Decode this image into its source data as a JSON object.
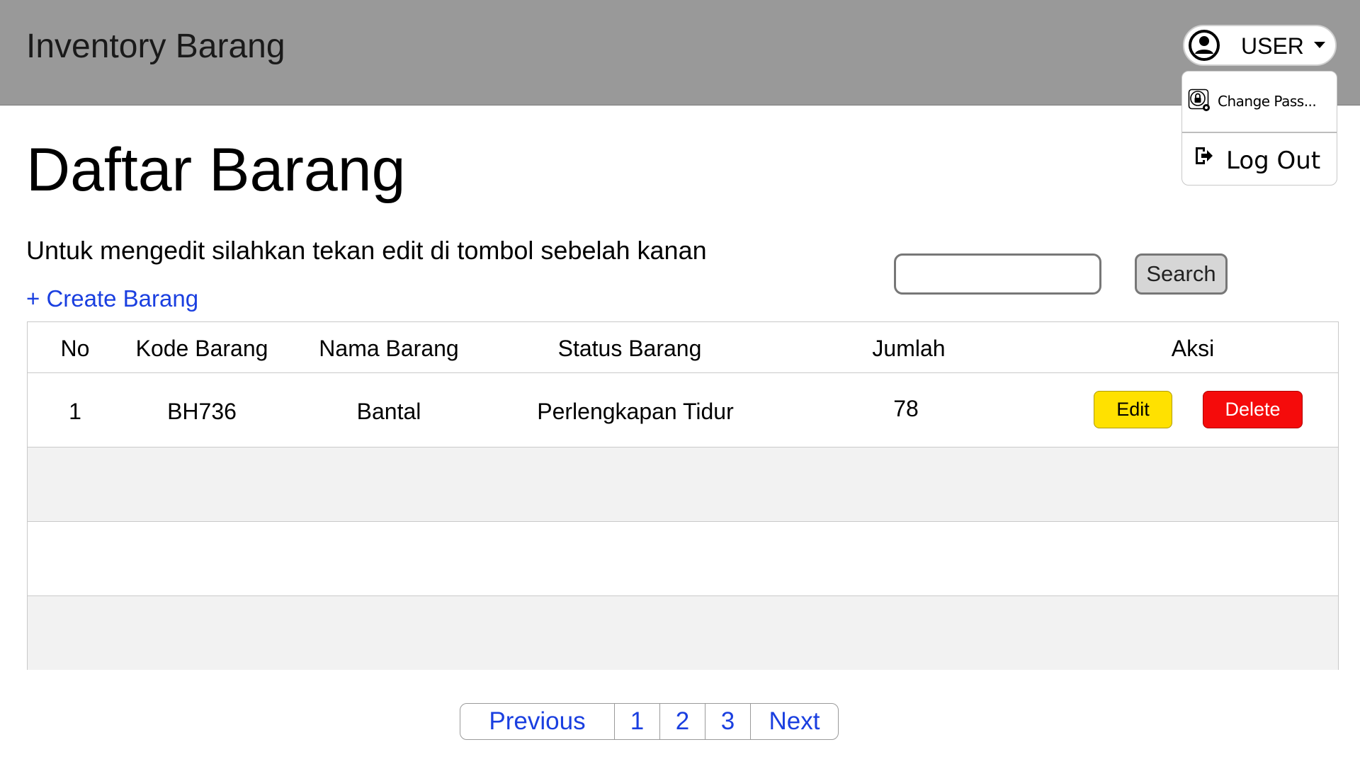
{
  "header": {
    "app_title": "Inventory Barang",
    "user_label": "USER",
    "dropdown": {
      "change_password": "Change Pass...",
      "logout": "Log Out"
    }
  },
  "main": {
    "page_title": "Daftar Barang",
    "instruction": "Untuk mengedit silahkan tekan edit di tombol sebelah kanan",
    "create_link": "+ Create Barang",
    "search": {
      "value": "",
      "placeholder": "",
      "button_label": "Search"
    }
  },
  "table": {
    "columns": [
      "No",
      "Kode Barang",
      "Nama Barang",
      "Status Barang",
      "Jumlah",
      "Aksi"
    ],
    "rows": [
      {
        "no": "1",
        "kode": "BH736",
        "nama": "Bantal",
        "status": "Perlengkapan Tidur",
        "jumlah": "78",
        "edit_label": "Edit",
        "delete_label": "Delete"
      }
    ]
  },
  "pagination": {
    "previous": "Previous",
    "pages": [
      "1",
      "2",
      "3"
    ],
    "next": "Next"
  },
  "colors": {
    "header_bg": "#999999",
    "link": "#1a3fe0",
    "edit_button": "#ffe100",
    "delete_button": "#f50b0b",
    "row_stripe": "#f2f2f2"
  },
  "icons": {
    "avatar": "user-avatar-icon",
    "caret": "caret-down-icon",
    "change_password": "lock-gear-icon",
    "logout": "logout-icon"
  }
}
